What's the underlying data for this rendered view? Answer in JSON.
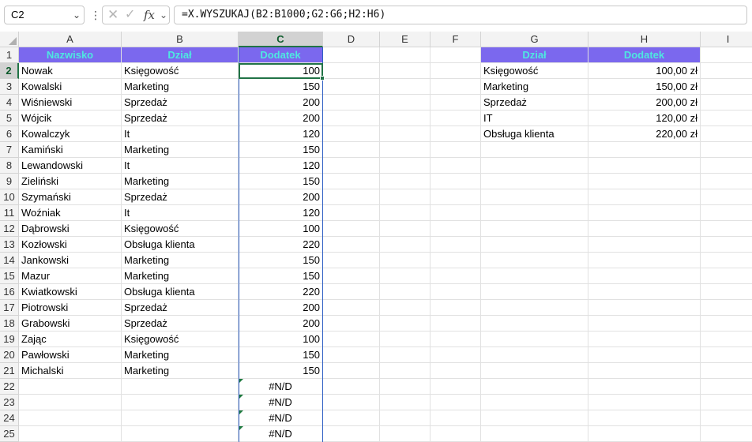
{
  "formula_bar": {
    "name_box": "C2",
    "dots": "⋮",
    "cancel_icon": "✕",
    "enter_icon": "✓",
    "fx_label": "fx",
    "formula": "=X.WYSZUKAJ(B2:B1000;G2:G6;H2:H6)"
  },
  "columns": [
    "A",
    "B",
    "C",
    "D",
    "E",
    "F",
    "G",
    "H",
    "I"
  ],
  "rows": [
    "1",
    "2",
    "3",
    "4",
    "5",
    "6",
    "7",
    "8",
    "9",
    "10",
    "11",
    "12",
    "13",
    "14",
    "15",
    "16",
    "17",
    "18",
    "19",
    "20",
    "21",
    "22",
    "23",
    "24",
    "25"
  ],
  "main_table": {
    "headers": [
      "Nazwisko",
      "Dział",
      "Dodatek"
    ],
    "rows": [
      [
        "Nowak",
        "Księgowość",
        "100"
      ],
      [
        "Kowalski",
        "Marketing",
        "150"
      ],
      [
        "Wiśniewski",
        "Sprzedaż",
        "200"
      ],
      [
        "Wójcik",
        "Sprzedaż",
        "200"
      ],
      [
        "Kowalczyk",
        "It",
        "120"
      ],
      [
        "Kamiński",
        "Marketing",
        "150"
      ],
      [
        "Lewandowski",
        "It",
        "120"
      ],
      [
        "Zieliński",
        "Marketing",
        "150"
      ],
      [
        "Szymański",
        "Sprzedaż",
        "200"
      ],
      [
        "Woźniak",
        "It",
        "120"
      ],
      [
        "Dąbrowski",
        "Księgowość",
        "100"
      ],
      [
        "Kozłowski",
        "Obsługa klienta",
        "220"
      ],
      [
        "Jankowski",
        "Marketing",
        "150"
      ],
      [
        "Mazur",
        "Marketing",
        "150"
      ],
      [
        "Kwiatkowski",
        "Obsługa klienta",
        "220"
      ],
      [
        "Piotrowski",
        "Sprzedaż",
        "200"
      ],
      [
        "Grabowski",
        "Sprzedaż",
        "200"
      ],
      [
        "Zając",
        "Księgowość",
        "100"
      ],
      [
        "Pawłowski",
        "Marketing",
        "150"
      ],
      [
        "Michalski",
        "Marketing",
        "150"
      ]
    ],
    "error_values": [
      "#N/D",
      "#N/D",
      "#N/D",
      "#N/D"
    ]
  },
  "lookup_table": {
    "headers": [
      "Dział",
      "Dodatek"
    ],
    "rows": [
      [
        "Księgowość",
        "100,00 zł"
      ],
      [
        "Marketing",
        "150,00 zł"
      ],
      [
        "Sprzedaż",
        "200,00 zł"
      ],
      [
        "IT",
        "120,00 zł"
      ],
      [
        "Obsługa klienta",
        "220,00 zł"
      ]
    ]
  },
  "colors": {
    "header_fill": "#7b68ee",
    "header_text": "#4ee8e0",
    "selection": "#217346"
  }
}
